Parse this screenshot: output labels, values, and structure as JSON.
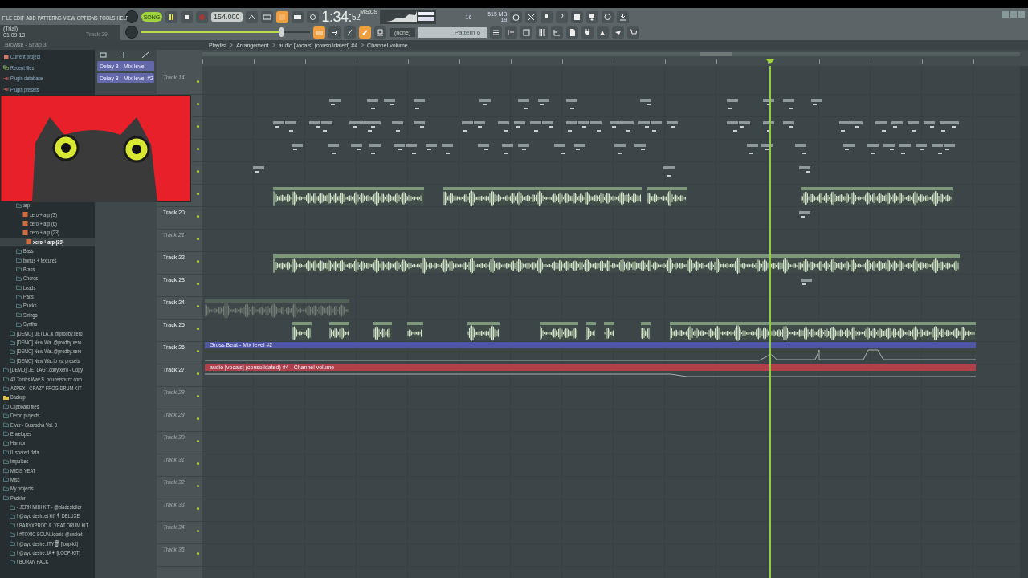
{
  "menu": [
    "FILE",
    "EDIT",
    "ADD",
    "PATTERNS",
    "VIEW",
    "OPTIONS",
    "TOOLS",
    "HELP"
  ],
  "hint": {
    "title": "(Trial)",
    "time": "01:09:13",
    "track": "Track 29"
  },
  "transport": {
    "song_mode": true,
    "mode_label": "SONG",
    "playing": true,
    "recording": false,
    "tempo": "154.000",
    "time": "1:34:",
    "time_fraction": "52",
    "time_unit": "M:S:CS",
    "master_volume": {
      "level": 0.82
    }
  },
  "monitor": {
    "cpu": "16",
    "memory": "515 MB",
    "polyphony": "19"
  },
  "pattern": {
    "channel": "(none)",
    "name": "Pattern 6"
  },
  "browser": {
    "title": "Browse - Snap 3",
    "items": [
      {
        "label": "Current project",
        "kind": "project"
      },
      {
        "label": "Recent files",
        "kind": "recent"
      },
      {
        "label": "Plugin database",
        "kind": "plugin"
      },
      {
        "label": "Plugin presets",
        "kind": "plugin"
      },
      {
        "children": [
          {
            "children": [
              {
                "label": "arp",
                "kind": "folder",
                "children": [
                  {
                    "label": "xero + arp (3)",
                    "kind": "file",
                    "selected": false
                  },
                  {
                    "label": "xero + arp (6)",
                    "kind": "file",
                    "selected": false
                  },
                  {
                    "label": "xero + arp (23)",
                    "kind": "file",
                    "selected": false
                  },
                  {
                    "label": "xero + arp (29)",
                    "kind": "file",
                    "selected": true
                  }
                ]
              },
              {
                "label": "Bass",
                "kind": "folder"
              },
              {
                "label": "bonus + textures",
                "kind": "folder"
              },
              {
                "label": "Brass",
                "kind": "folder"
              },
              {
                "label": "Chords",
                "kind": "folder"
              },
              {
                "label": "Leads",
                "kind": "folder"
              },
              {
                "label": "Pads",
                "kind": "folder"
              },
              {
                "label": "Plucks",
                "kind": "folder"
              },
              {
                "label": "Strings",
                "kind": "folder"
              },
              {
                "label": "Synths",
                "kind": "folder"
              }
            ]
          },
          {
            "label": "[DEMO] 'JETLA..k @prodby.xero",
            "kind": "folder"
          },
          {
            "label": "[DEMO] New Wa..@prodby.xero",
            "kind": "folder"
          },
          {
            "label": "[DEMO] New Wa..@prodby.xero",
            "kind": "folder"
          },
          {
            "label": "[DEMO] New Wa..lo vst presets",
            "kind": "folder"
          }
        ]
      },
      {
        "label": "[DEMO] 'JETLAG'..odby.xero - Copy",
        "kind": "folder"
      },
      {
        "label": "43 Tombs Wav S..oducersbuzz.com",
        "kind": "folder"
      },
      {
        "label": "AZPEX - CRAZY FROG DRUM KIT",
        "kind": "folder"
      },
      {
        "label": "Backup",
        "kind": "backup"
      },
      {
        "label": "Clipboard files",
        "kind": "folder"
      },
      {
        "label": "Demo projects",
        "kind": "folder"
      },
      {
        "label": "Elver - Guaracha Vol. 3",
        "kind": "folder"
      },
      {
        "label": "Envelopes",
        "kind": "folder"
      },
      {
        "label": "Harmor",
        "kind": "folder"
      },
      {
        "label": "IL shared data",
        "kind": "folder"
      },
      {
        "label": "Impulses",
        "kind": "folder"
      },
      {
        "label": "MIDIS YEAT",
        "kind": "folder"
      },
      {
        "label": "Misc",
        "kind": "folder"
      },
      {
        "label": "My projects",
        "kind": "folder"
      },
      {
        "label": "Packler",
        "kind": "folder",
        "children": [
          {
            "label": "- JERK MIDI KIT - @bladesteller",
            "kind": "folder"
          },
          {
            "label": "!   @ayo desir..et kit] ↟ DELUXE",
            "kind": "folder"
          },
          {
            "label": "!   BABYXPROD &..YEAT DRUM KIT",
            "kind": "folder"
          },
          {
            "label": "! #TOXIC SOUN..iconic @cxsket",
            "kind": "folder"
          },
          {
            "label": "! @ayo desire..ITY🗑 [loop-kit]",
            "kind": "folder"
          },
          {
            "label": "! @ayo desire..IA✦ [LOOP-KIT]",
            "kind": "folder"
          },
          {
            "label": "! BORAN PACK",
            "kind": "folder"
          }
        ]
      }
    ]
  },
  "playlist": {
    "breadcrumb": [
      "Playlist",
      "Arrangement",
      "audio [vocals] (consolidated) #4",
      "Channel volume"
    ],
    "picker": [
      {
        "label": "Delay 3 - Mix level"
      },
      {
        "label": "Delay 3 - Mix level #2"
      }
    ],
    "tracks": [
      {
        "label": "Track 14",
        "dim": true,
        "kind": "empty"
      },
      {
        "kind": "notes"
      },
      {
        "kind": "notes"
      },
      {
        "kind": "notes"
      },
      {
        "kind": "notes"
      },
      {
        "kind": "audio"
      },
      {
        "label": "Track 20",
        "dim": false,
        "kind": "notes"
      },
      {
        "label": "Track 21",
        "dim": true,
        "kind": "empty"
      },
      {
        "label": "Track 22",
        "dim": false,
        "kind": "audio"
      },
      {
        "label": "Track 23",
        "dim": false,
        "kind": "notes"
      },
      {
        "label": "Track 24",
        "dim": false,
        "kind": "audio"
      },
      {
        "label": "Track 25",
        "dim": false,
        "kind": "audio"
      },
      {
        "label": "Track 26",
        "dim": false,
        "kind": "automation",
        "clip": {
          "label": "Gross Beat - Mix level #2",
          "color": "#4e55a2"
        }
      },
      {
        "label": "Track 27",
        "dim": false,
        "kind": "automation",
        "clip": {
          "label": "audio [vocals] (consolidated) #4 - Channel volume",
          "color": "#b0414a"
        }
      },
      {
        "label": "Track 28",
        "dim": true,
        "kind": "empty"
      },
      {
        "label": "Track 29",
        "dim": true,
        "kind": "empty"
      },
      {
        "label": "Track 30",
        "dim": true,
        "kind": "empty"
      },
      {
        "label": "Track 31",
        "dim": true,
        "kind": "empty"
      },
      {
        "label": "Track 32",
        "dim": true,
        "kind": "empty"
      },
      {
        "label": "Track 33",
        "dim": true,
        "kind": "empty"
      },
      {
        "label": "Track 34",
        "dim": true,
        "kind": "empty"
      },
      {
        "label": "Track 35",
        "dim": true,
        "kind": "empty"
      }
    ]
  }
}
